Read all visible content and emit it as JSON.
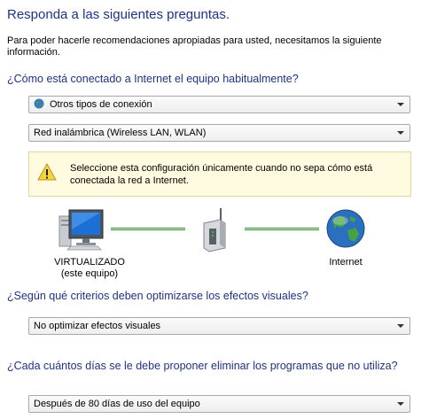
{
  "page": {
    "heading": "Responda a las siguientes preguntas.",
    "intro": "Para poder hacerle recomendaciones apropiadas para usted, necesitamos la siguiente información."
  },
  "connection": {
    "question": "¿Cómo está conectado a Internet el equipo habitualmente?",
    "type_select": {
      "value": "Otros tipos de conexión",
      "icon": "globe-icon"
    },
    "network_select": {
      "value": "Red inalámbrica (Wireless LAN, WLAN)"
    },
    "warning": {
      "icon": "warning-icon",
      "text": "Seleccione esta configuración únicamente cuando no sepa cómo está conectada la red a Internet."
    }
  },
  "diagram": {
    "computer_label_line1": "VIRTUALIZADO",
    "computer_label_line2": "(este equipo)",
    "router_icon": "router-icon",
    "internet_label": "Internet",
    "link_color": "#2a8a2a"
  },
  "visual_effects": {
    "question": "¿Según qué criterios deben optimizarse los efectos visuales?",
    "select": {
      "value": "No optimizar efectos visuales"
    }
  },
  "unused_programs": {
    "question": "¿Cada cuántos días se le debe proponer eliminar los programas que no utiliza?",
    "select": {
      "value": "Después de 80 días de uso del equipo"
    }
  },
  "colors": {
    "heading": "#1e3287",
    "warning_background": "#fffbe0",
    "warning_border": "#e8d897"
  }
}
